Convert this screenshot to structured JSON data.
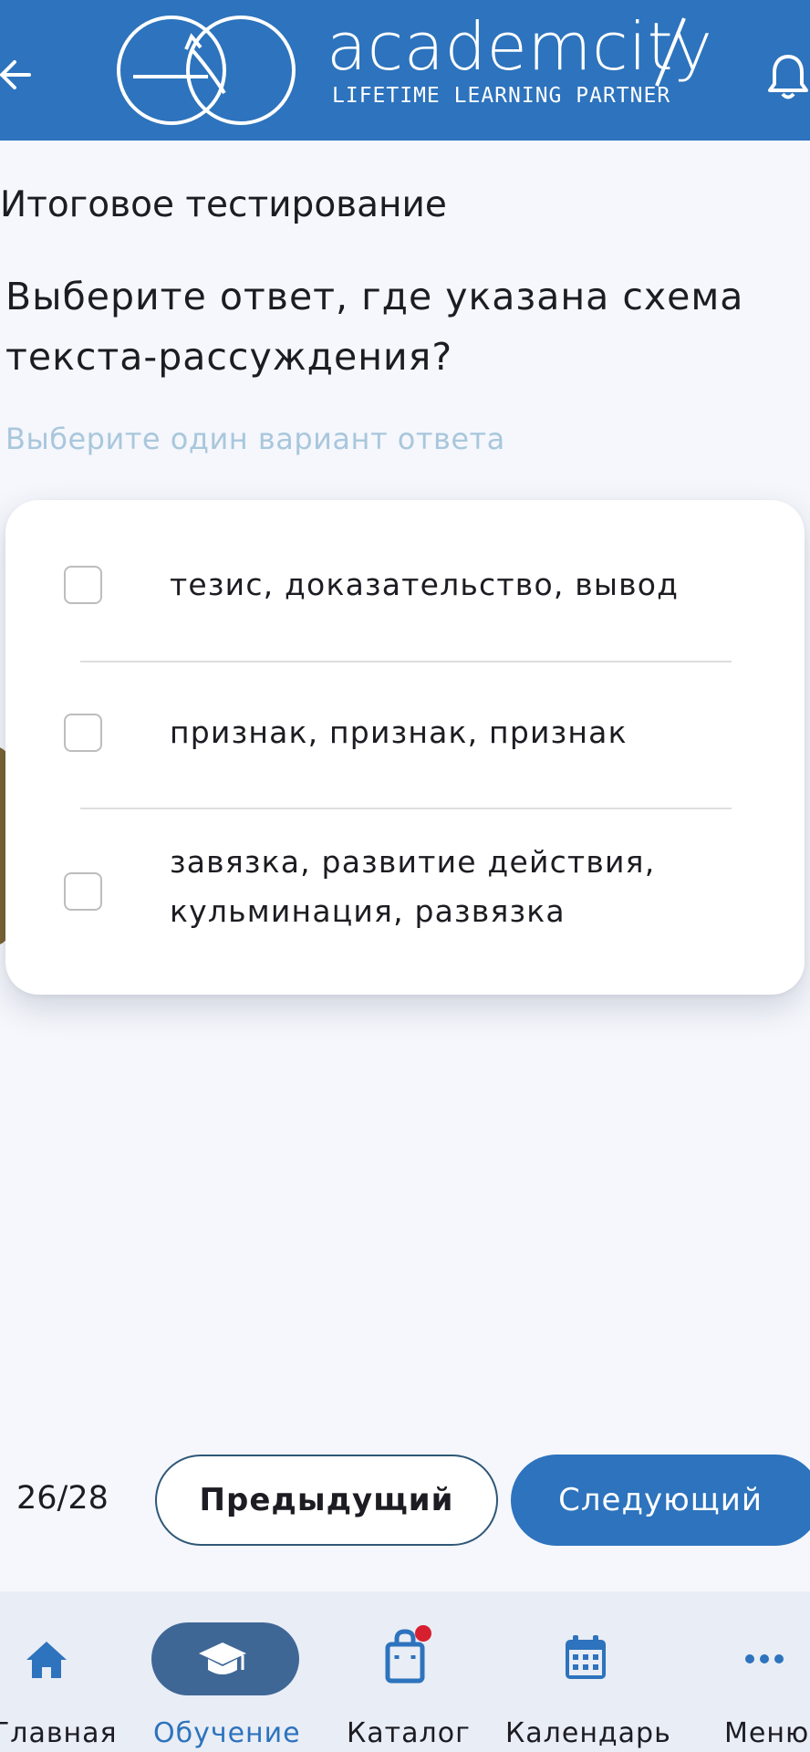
{
  "header": {
    "brand": "academcity",
    "tagline": "LIFETIME LEARNING PARTNER",
    "back_icon": "arrow-left-icon",
    "bell_icon": "bell-icon",
    "background": "#2d73bd"
  },
  "page_title": "Итоговое тестирование",
  "question": {
    "text": "Выберите ответ, где указана схема текста-рассуждения?",
    "hint": "Выберите один вариант ответа"
  },
  "options": [
    {
      "label": "тезис, доказательство, вывод",
      "checked": false
    },
    {
      "label": "признак, признак, признак",
      "checked": false
    },
    {
      "label": "завязка, развитие действия, кульминация, развязка",
      "checked": false
    }
  ],
  "pager": {
    "counter": "26/28",
    "prev_label": "Предыдущий",
    "next_label": "Следующий"
  },
  "nav": {
    "items": [
      {
        "label": "Главная",
        "icon": "home-icon",
        "active": false
      },
      {
        "label": "Обучение",
        "icon": "graduation-cap-icon",
        "active": true
      },
      {
        "label": "Каталог",
        "icon": "shopping-bag-icon",
        "active": false,
        "badge": true
      },
      {
        "label": "Календарь",
        "icon": "calendar-icon",
        "active": false
      },
      {
        "label": "Меню",
        "icon": "more-icon",
        "active": false
      }
    ],
    "active_color": "#2d73bd",
    "badge_color": "#d62030"
  }
}
